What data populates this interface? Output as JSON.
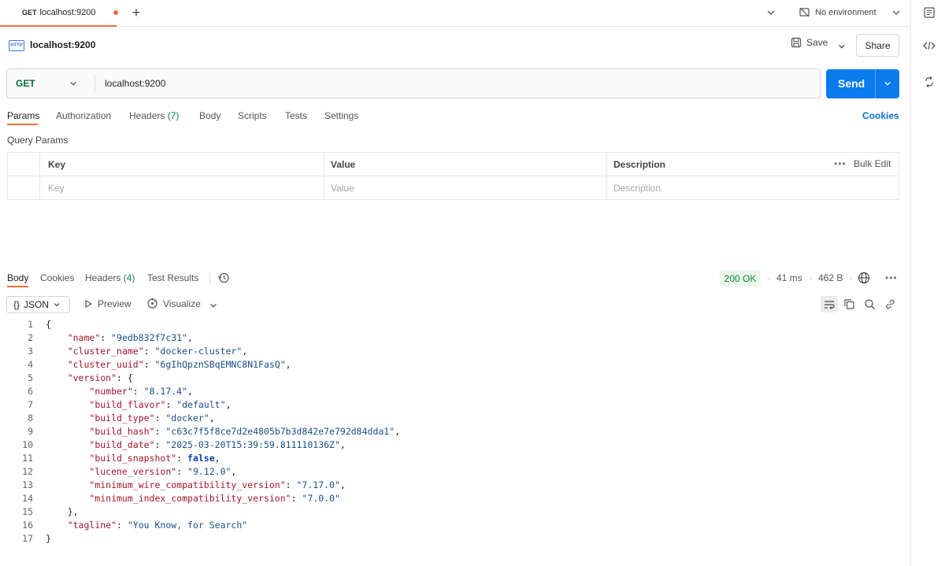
{
  "tab": {
    "method": "GET",
    "title": "localhost:9200",
    "dot_color": "#f26b3a"
  },
  "environment": {
    "label": "No environment"
  },
  "request": {
    "badge": "HTTP",
    "title": "localhost:9200",
    "save_label": "Save",
    "share_label": "Share",
    "method": "GET",
    "url": "localhost:9200",
    "send_label": "Send"
  },
  "request_tabs": {
    "params": "Params",
    "authorization": "Authorization",
    "headers": "Headers",
    "headers_count": "(7)",
    "body": "Body",
    "scripts": "Scripts",
    "tests": "Tests",
    "settings": "Settings",
    "cookies": "Cookies"
  },
  "query_params": {
    "label": "Query Params",
    "columns": [
      "Key",
      "Value",
      "Description"
    ],
    "placeholders": [
      "Key",
      "Value",
      "Description"
    ],
    "bulk_edit": "Bulk Edit",
    "more": "•••"
  },
  "response_tabs": {
    "body": "Body",
    "cookies": "Cookies",
    "headers": "Headers",
    "headers_count": "(4)",
    "test_results": "Test Results"
  },
  "response_meta": {
    "status": "200 OK",
    "time": "41 ms",
    "size": "462 B",
    "more": "•••"
  },
  "response_toolbar": {
    "format_icon": "{}",
    "format": "JSON",
    "preview": "Preview",
    "visualize": "Visualize"
  },
  "code": {
    "line_numbers": [
      "1",
      "2",
      "3",
      "4",
      "5",
      "6",
      "7",
      "8",
      "9",
      "10",
      "11",
      "12",
      "13",
      "14",
      "15",
      "16",
      "17"
    ]
  },
  "colors": {
    "accent": "#f26b3a",
    "send": "#097bed",
    "status_ok": "#0b8a3c",
    "link": "#0a6fd6"
  }
}
